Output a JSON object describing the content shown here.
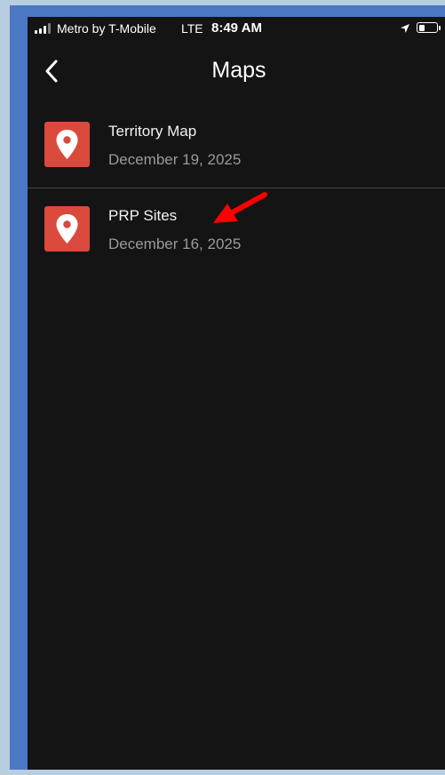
{
  "status_bar": {
    "carrier": "Metro by T-Mobile",
    "network": "LTE",
    "time": "8:49 AM",
    "battery_level": 0.35
  },
  "nav": {
    "title": "Maps",
    "back_icon": "chevron-left-icon"
  },
  "maps": [
    {
      "title": "Territory Map",
      "date": "December 19, 2025",
      "icon": "map-pin-icon"
    },
    {
      "title": "PRP Sites",
      "date": "December 16, 2025",
      "icon": "map-pin-icon"
    }
  ],
  "colors": {
    "background": "#141414",
    "icon_background": "#d94a3d",
    "annotation_arrow": "#ff0000",
    "frame_border": "#4a78c2"
  }
}
